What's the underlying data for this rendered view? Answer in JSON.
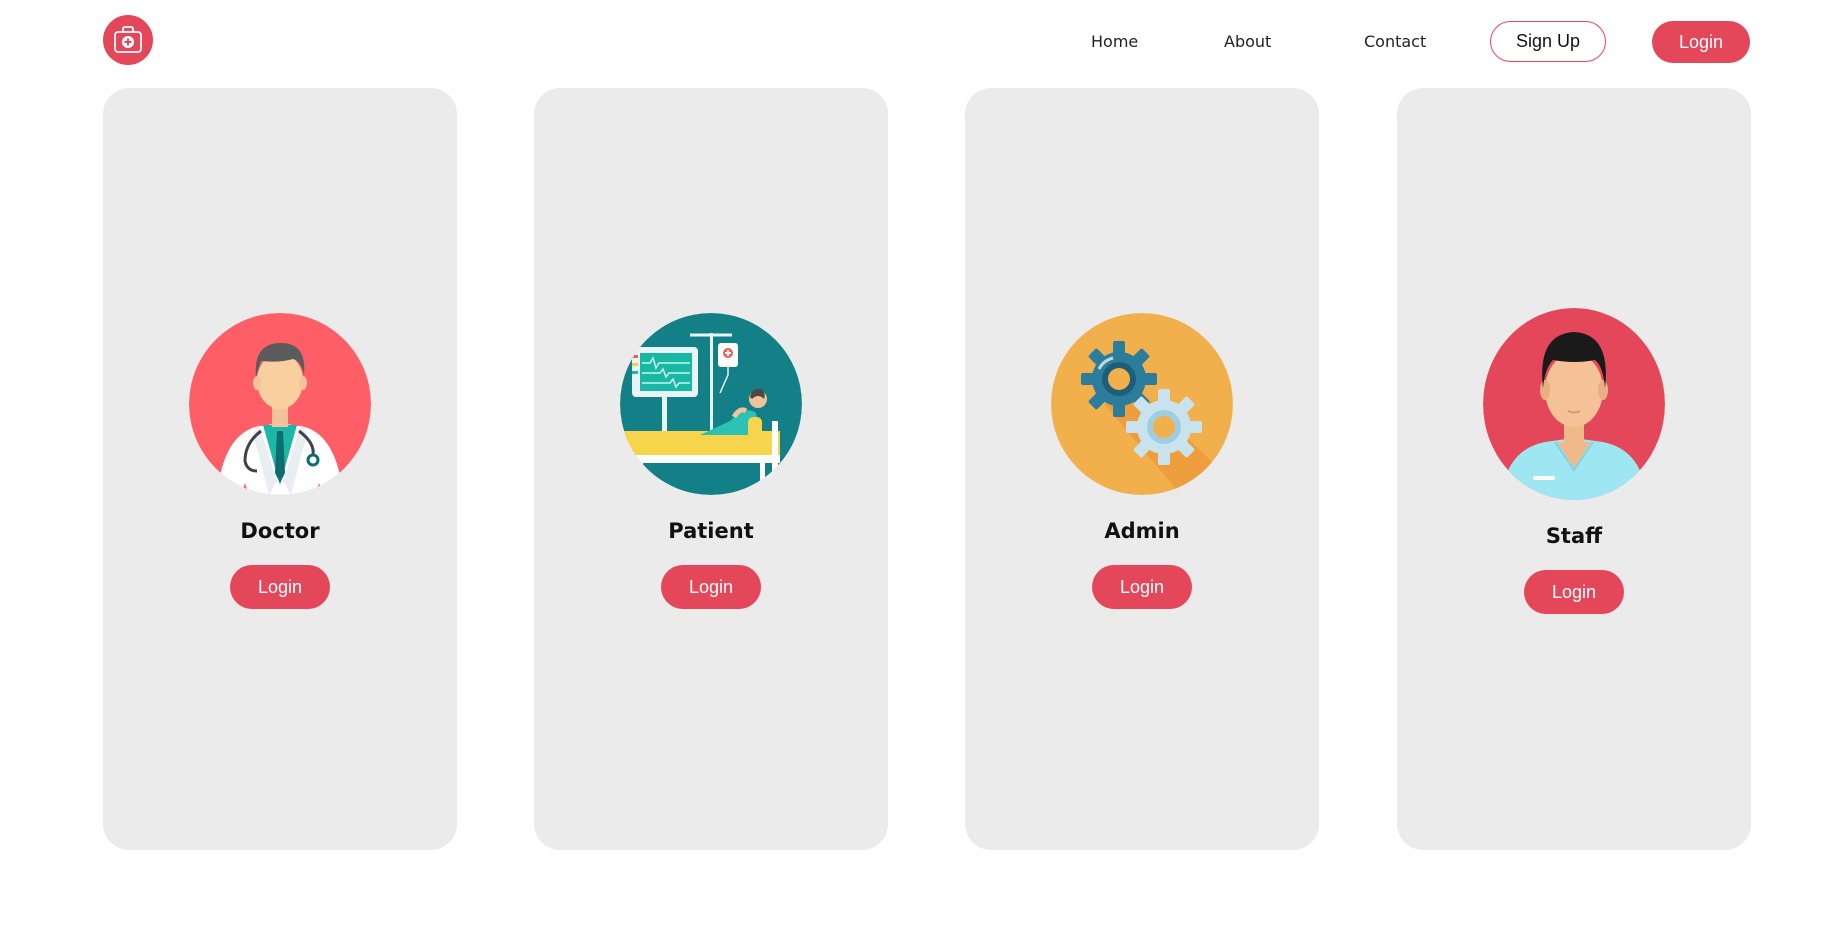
{
  "header": {
    "nav": {
      "home": "Home",
      "about": "About",
      "contact": "Contact"
    },
    "signup_label": "Sign Up",
    "login_label": "Login"
  },
  "cards": [
    {
      "title": "Doctor",
      "button_label": "Login",
      "icon": "doctor-icon"
    },
    {
      "title": "Patient",
      "button_label": "Login",
      "icon": "patient-icon"
    },
    {
      "title": "Admin",
      "button_label": "Login",
      "icon": "gears-icon"
    },
    {
      "title": "Staff",
      "button_label": "Login",
      "icon": "staff-icon"
    }
  ],
  "colors": {
    "accent": "#e5475a",
    "card_background": "#ebebeb",
    "doctor_circle": "#fe5f67",
    "patient_circle": "#137f87",
    "admin_circle": "#f1b04c",
    "staff_circle": "#e5475a"
  }
}
